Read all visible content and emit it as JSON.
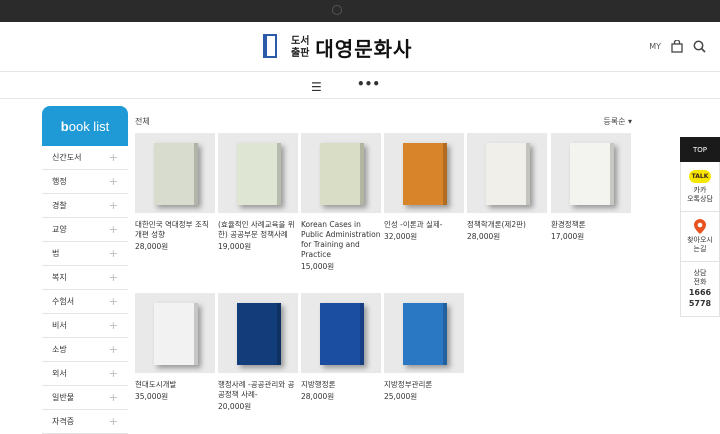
{
  "header": {
    "logo_line1": "도서",
    "logo_line2": "출판",
    "logo_name": "대영문화사",
    "my_label": "MY"
  },
  "nav": {
    "menu_icon": "hamburger-icon",
    "more_label": "•••"
  },
  "sidebar": {
    "title_b": "b",
    "title_rest": "ook list",
    "categories": [
      "신간도서",
      "행정",
      "경찰",
      "교양",
      "법",
      "복지",
      "수험서",
      "비서",
      "소방",
      "외서",
      "일반물",
      "자격증"
    ]
  },
  "main": {
    "filter_label": "전체",
    "sort_label": "등록순",
    "books": [
      {
        "title": "대한민국 역대정부 조직개편 성향",
        "price": "28,000원",
        "cover_color": "#d7dccf"
      },
      {
        "title": "(효율적인 사례교육을 위한) 공공부문 정책사례",
        "price": "19,000원",
        "cover_color": "#dfe5d3"
      },
      {
        "title": "Korean Cases in Public Administration for Training and Practice",
        "price": "15,000원",
        "cover_color": "#d9ddc6"
      },
      {
        "title": "인성 -이론과 실제-",
        "price": "32,000원",
        "cover_color": "#d8842a"
      },
      {
        "title": "정책학개론(제2판)",
        "price": "28,000원",
        "cover_color": "#f0efe9"
      },
      {
        "title": "환경정책론",
        "price": "17,000원",
        "cover_color": "#f3f3f0"
      },
      {
        "title": "현대도시개발",
        "price": "35,000원",
        "cover_color": "#f2f2f2"
      },
      {
        "title": "행정사례 -공공관리와 공공정책 사례-",
        "price": "20,000원",
        "cover_color": "#123d7a"
      },
      {
        "title": "지방행정론",
        "price": "28,000원",
        "cover_color": "#1b4ea0"
      },
      {
        "title": "지방정부관리론",
        "price": "25,000원",
        "cover_color": "#2a77c4"
      }
    ]
  },
  "rightbar": {
    "top_label": "TOP",
    "kakao_badge": "TALK",
    "kakao_line1": "카카",
    "kakao_line2": "오톡상담",
    "map_line1": "찾아오시",
    "map_line2": "는길",
    "phone_line1": "상담",
    "phone_line2": "전화",
    "phone_num1": "1666",
    "phone_num2": "5778"
  }
}
